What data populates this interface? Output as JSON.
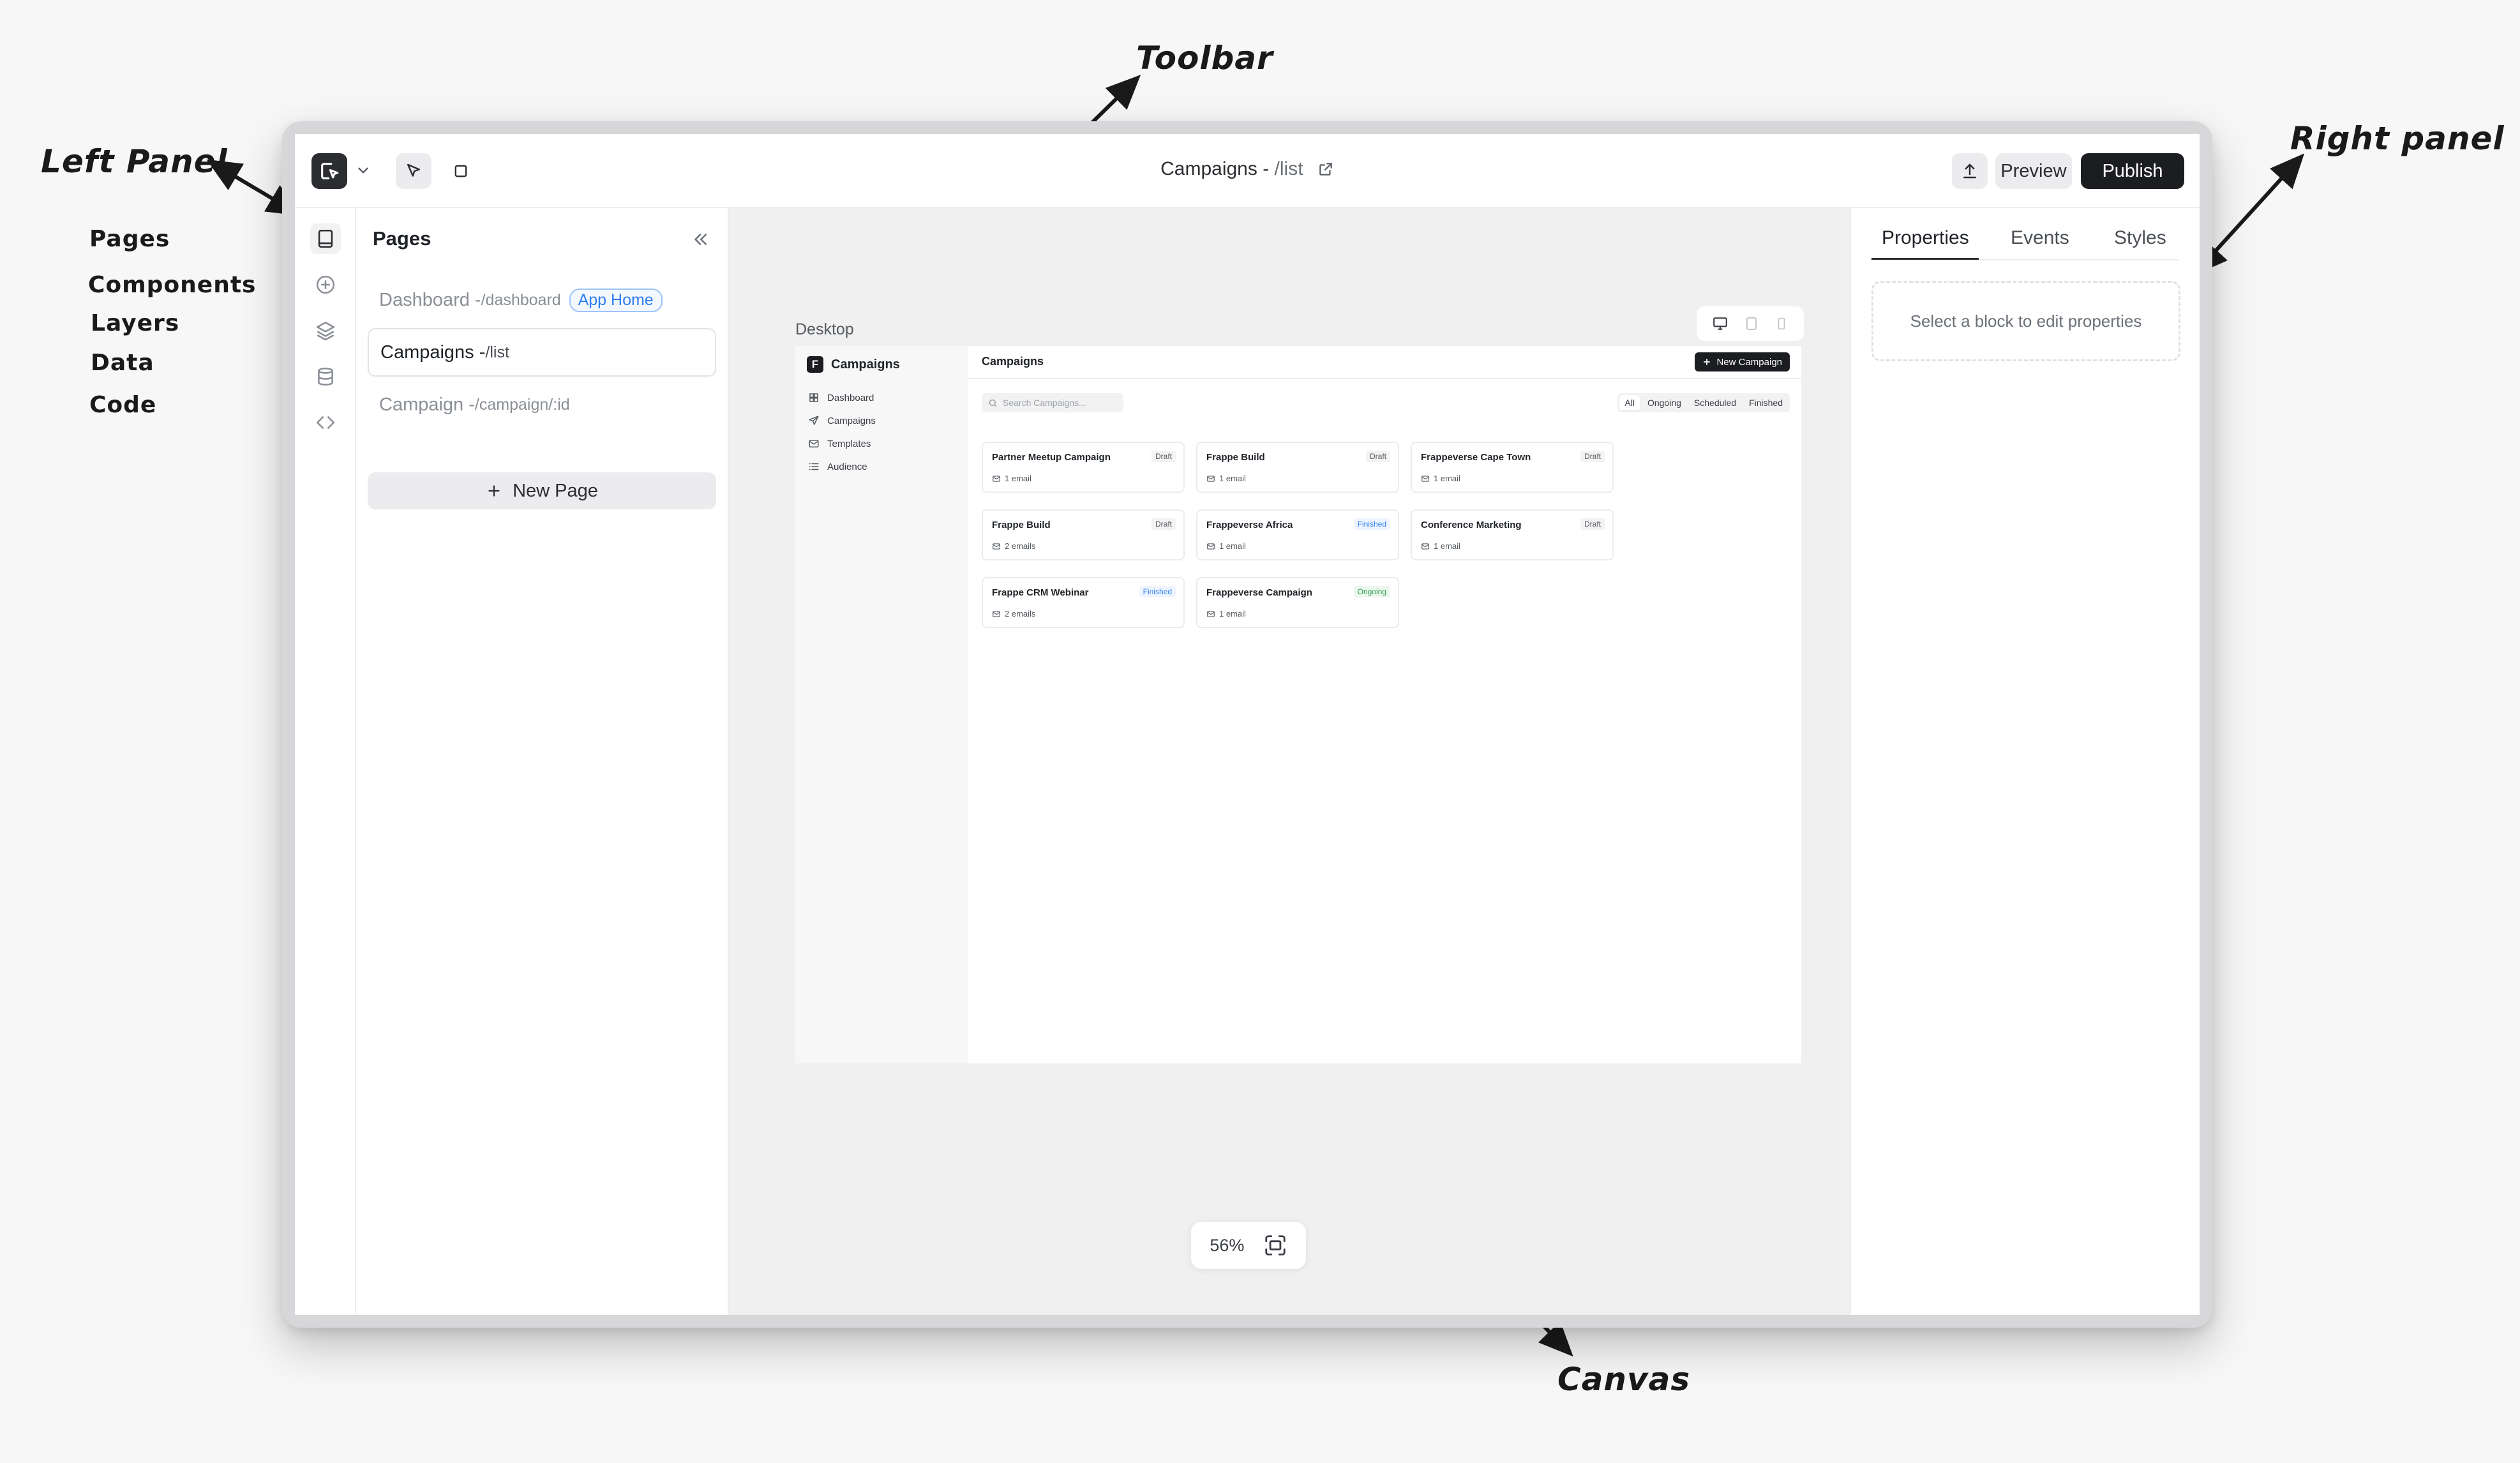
{
  "annotations": {
    "toolbar": "Toolbar",
    "left_panel": "Left Panel",
    "right_panel": "Right panel",
    "canvas": "Canvas",
    "left_items": [
      "Pages",
      "Components",
      "Layers",
      "Data",
      "Code"
    ]
  },
  "toolbar": {
    "title": "Campaigns - ",
    "route": "/list",
    "preview_label": "Preview",
    "publish_label": "Publish"
  },
  "pages_panel": {
    "title": "Pages",
    "items": [
      {
        "name": "Dashboard - ",
        "route": "/dashboard",
        "badge": "App Home",
        "active": false
      },
      {
        "name": "Campaigns - ",
        "route": "/list",
        "active": true
      },
      {
        "name": "Campaign - ",
        "route": "/campaign/:id",
        "active": false
      }
    ],
    "new_page_label": "New Page"
  },
  "canvas": {
    "device_label": "Desktop",
    "zoom": "56%"
  },
  "preview_app": {
    "brand": "Campaigns",
    "brand_letter": "F",
    "nav": [
      "Dashboard",
      "Campaigns",
      "Templates",
      "Audience"
    ],
    "page_title": "Campaigns",
    "new_button": "New Campaign",
    "search_placeholder": "Search Campaigns...",
    "filters": [
      "All",
      "Ongoing",
      "Scheduled",
      "Finished"
    ],
    "cards": [
      {
        "name": "Partner Meetup Campaign",
        "status": "Draft",
        "meta": "1 email"
      },
      {
        "name": "Frappe Build",
        "status": "Draft",
        "meta": "1 email"
      },
      {
        "name": "Frappeverse Cape Town",
        "status": "Draft",
        "meta": "1 email"
      },
      {
        "name": "Frappe Build",
        "status": "Draft",
        "meta": "2 emails"
      },
      {
        "name": "Frappeverse Africa",
        "status": "Finished",
        "meta": "1 email"
      },
      {
        "name": "Conference Marketing",
        "status": "Draft",
        "meta": "1 email"
      },
      {
        "name": "Frappe CRM Webinar",
        "status": "Finished",
        "meta": "2 emails"
      },
      {
        "name": "Frappeverse Campaign",
        "status": "Ongoing",
        "meta": "1 email"
      }
    ]
  },
  "right_panel": {
    "tabs": [
      "Properties",
      "Events",
      "Styles"
    ],
    "empty_message": "Select a block to edit properties"
  }
}
